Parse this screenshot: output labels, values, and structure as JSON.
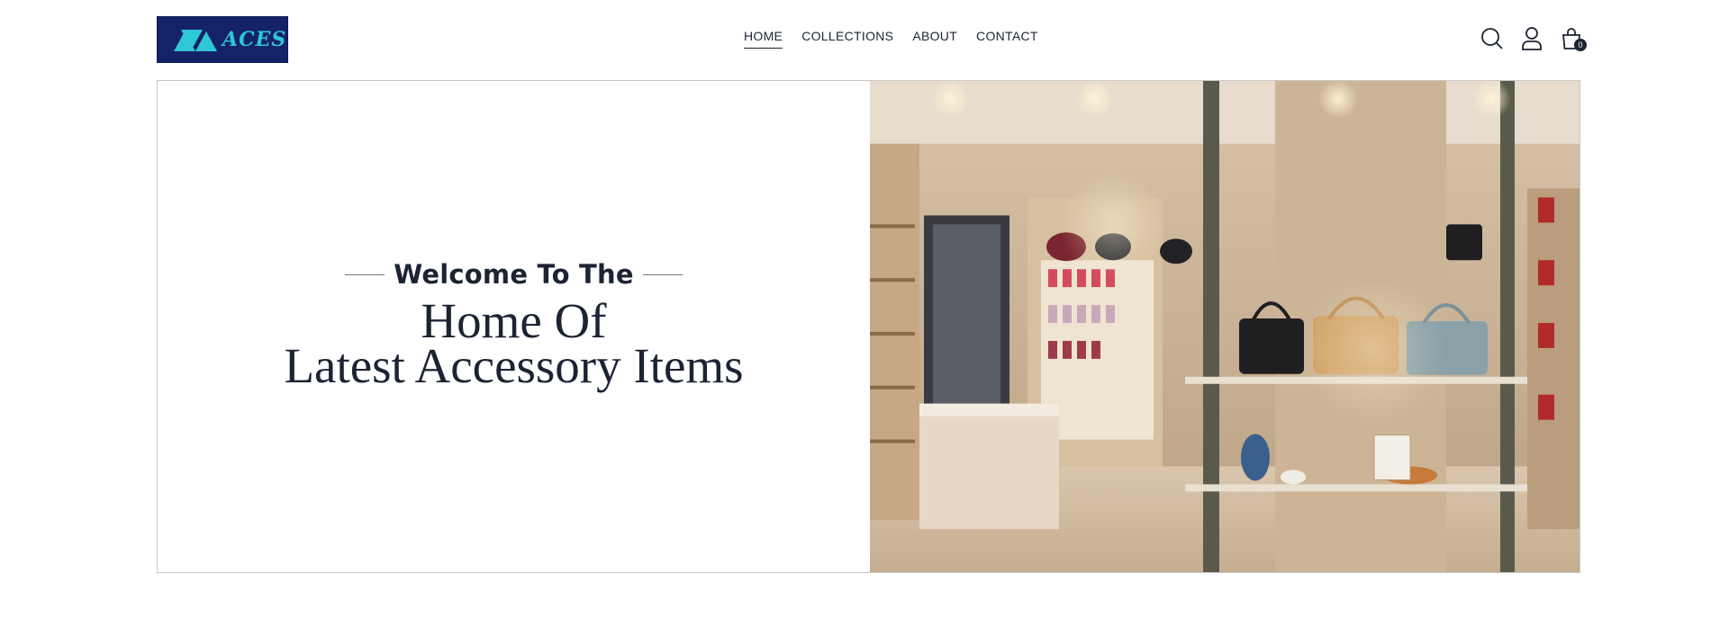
{
  "brand": {
    "name": "ACES",
    "bg": "#14226a",
    "accent": "#2fc6d6"
  },
  "nav": {
    "items": [
      {
        "label": "HOME",
        "active": true
      },
      {
        "label": "COLLECTIONS",
        "active": false
      },
      {
        "label": "ABOUT",
        "active": false
      },
      {
        "label": "CONTACT",
        "active": false
      }
    ]
  },
  "header_icons": {
    "search": "search-icon",
    "account": "user-icon",
    "cart": "shopping-bag-icon",
    "cart_count": "0"
  },
  "hero": {
    "subheading": "Welcome To The",
    "heading_line1": "Home Of",
    "heading_line2": "Latest Accessory Items",
    "image": "store-interior-image"
  },
  "colors": {
    "text": "#1c2333",
    "border": "#c9c9c9"
  }
}
